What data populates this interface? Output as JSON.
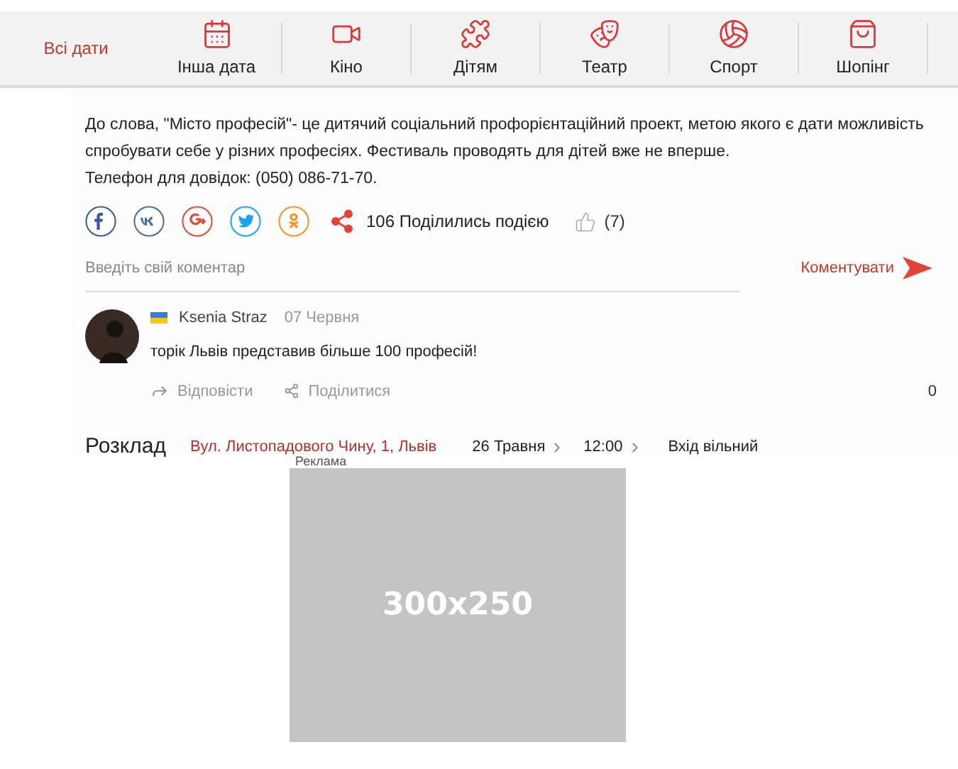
{
  "nav": [
    {
      "label": "Всі дати",
      "kind": "all",
      "selected": true
    },
    {
      "label": "Інша дата",
      "kind": "calendar",
      "selected": false
    },
    {
      "label": "Кіно",
      "kind": "video",
      "selected": false
    },
    {
      "label": "Дітям",
      "kind": "puzzle",
      "selected": false
    },
    {
      "label": "Театр",
      "kind": "masks",
      "selected": false
    },
    {
      "label": "Спорт",
      "kind": "ball",
      "selected": false
    },
    {
      "label": "Шопінг",
      "kind": "bag",
      "selected": false
    }
  ],
  "description": [
    "До слова, \"Місто професій\"- це дитячий соціальний профорієнтаційний проект, метою якого є дати можливість спробувати себе у різних професіях. Фестиваль проводять для дітей вже не вперше.",
    "Телефон для довідок: (050) 086-71-70."
  ],
  "share": {
    "networks": [
      {
        "kind": "facebook",
        "color": "#3b5998"
      },
      {
        "kind": "vk",
        "color": "#4c6c91"
      },
      {
        "kind": "google",
        "color": "#dd4b39"
      },
      {
        "kind": "twitter",
        "color": "#1da1f2"
      },
      {
        "kind": "ok",
        "color": "#f7931e"
      }
    ],
    "count_text": "106 Поділились подією",
    "likes": "(7)"
  },
  "comment_form": {
    "placeholder": "Введіть свій коментар",
    "submit": "Коментувати"
  },
  "comments": [
    {
      "author": "Ksenia Straz",
      "date": "07 Червня",
      "text": "торік Львів представив більше 100 професій!",
      "reply": "Відповісти",
      "share": "Поділитися",
      "count": "0"
    }
  ],
  "schedule": {
    "title": "Розклад",
    "address": "Вул. Листопадового Чину, 1, Львів",
    "date": "26 Травня",
    "time": "12:00",
    "price": "Вхід вільний"
  },
  "ad": {
    "label": "Реклама",
    "size": "300x250"
  }
}
